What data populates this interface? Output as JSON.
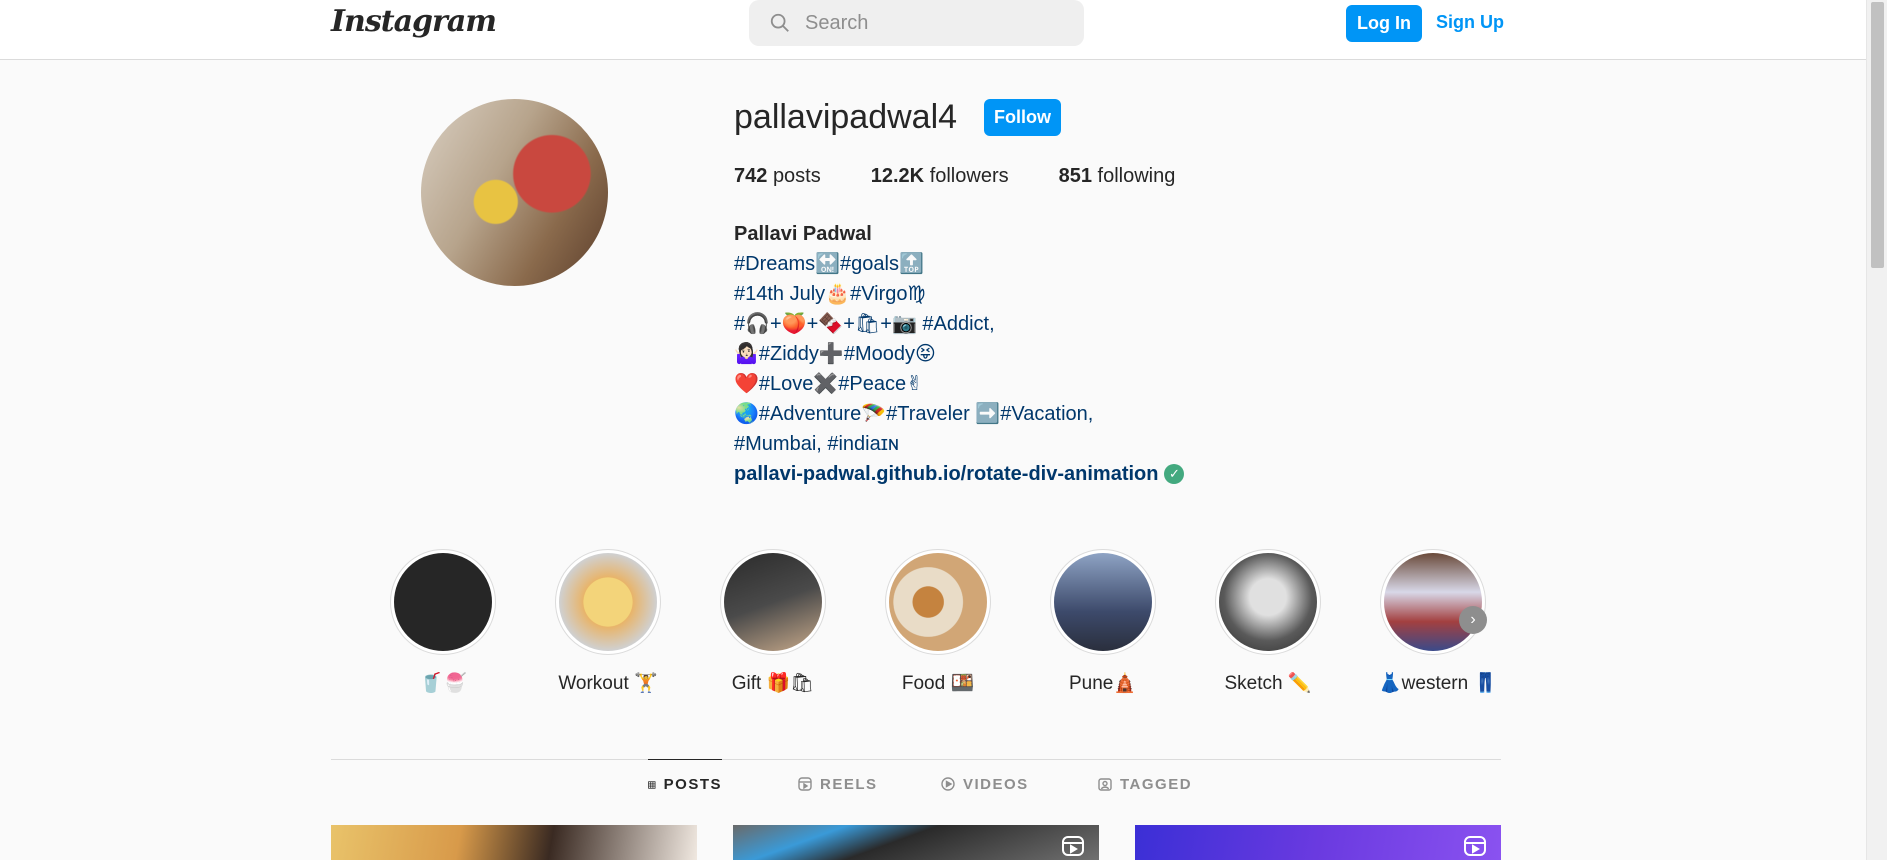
{
  "nav": {
    "logo": "Instagram",
    "search_placeholder": "Search",
    "login_label": "Log In",
    "signup_label": "Sign Up"
  },
  "profile": {
    "username": "pallavipadwal4",
    "follow_label": "Follow",
    "stats": {
      "posts_count": "742",
      "posts_label": "posts",
      "followers_count": "12.2K",
      "followers_label": "followers",
      "following_count": "851",
      "following_label": "following"
    },
    "bio": {
      "full_name": "Pallavi Padwal",
      "lines": [
        "#Dreams🔛#goals🔝",
        "#14th July🎂#Virgo♍",
        "#🎧+🍑+🍫+🛍+📷 #Addict,",
        "🤷🏻‍♀️#Ziddy➕#Moody😝",
        "❤️#Love✖️#Peace✌",
        "🌏#Adventure🪂#Traveler ➡️#Vacation,",
        "#Mumbai, #indiaɪɴ"
      ],
      "link": "pallavi-padwal.github.io/rotate-div-animation"
    }
  },
  "highlights": [
    {
      "label": "🥤🍧",
      "color": "#262626"
    },
    {
      "label": "Workout 🏋",
      "color": "#e8b46a"
    },
    {
      "label": "Gift 🎁🛍",
      "color": "#4a4a4a"
    },
    {
      "label": "Food 🍱",
      "color": "#d1a676"
    },
    {
      "label": "Pune🛕",
      "color": "#3d4a6b"
    },
    {
      "label": "Sketch ✏️",
      "color": "#9a9a9a"
    },
    {
      "label": "👗western 👖",
      "color": "#a34040"
    }
  ],
  "tabs": [
    {
      "label": "POSTS",
      "icon": "grid-icon"
    },
    {
      "label": "REELS",
      "icon": "reels-icon"
    },
    {
      "label": "VIDEOS",
      "icon": "play-icon"
    },
    {
      "label": "TAGGED",
      "icon": "tag-icon"
    }
  ],
  "colors": {
    "accent": "#0095f6",
    "link": "#00376b"
  }
}
